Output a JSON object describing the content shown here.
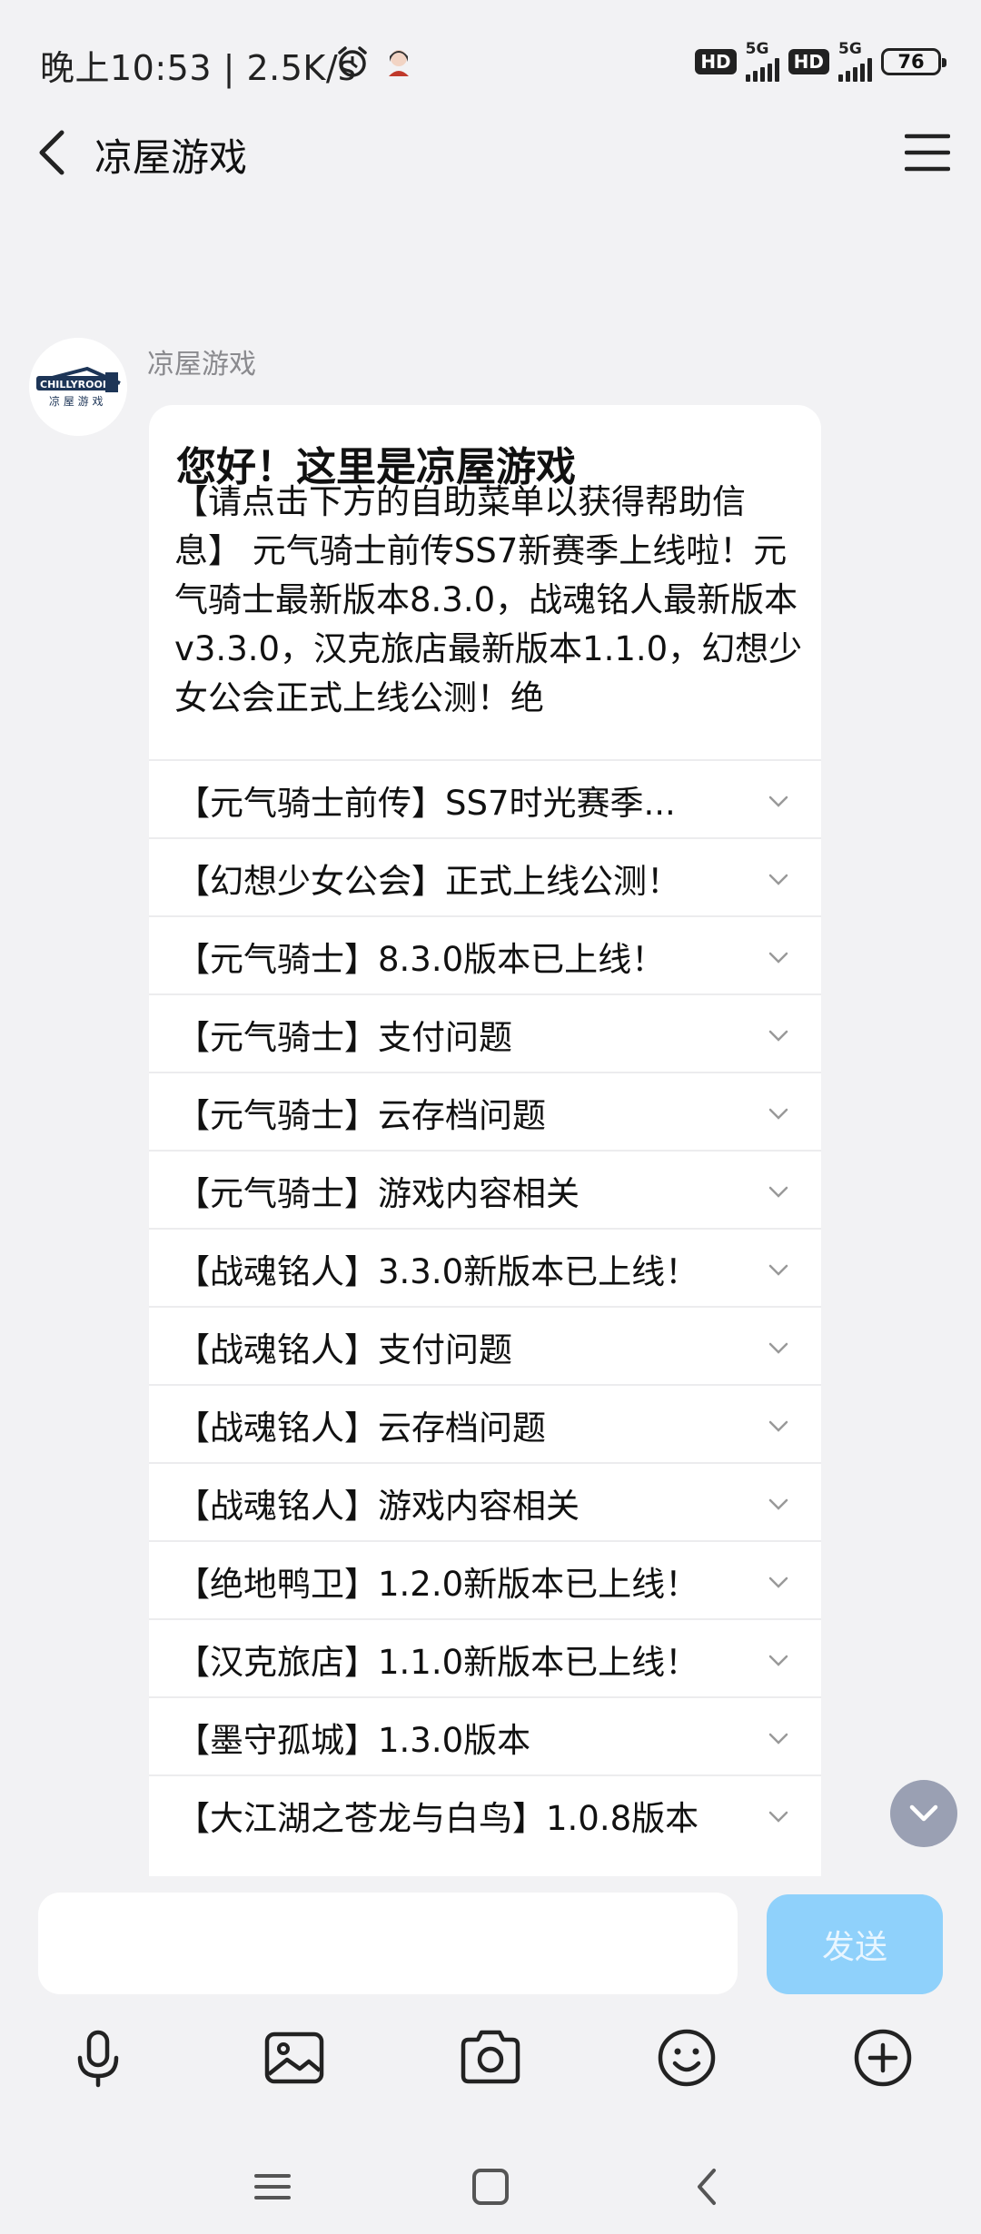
{
  "status_bar": {
    "time_text": "晚上10:53 | 2.5K/s",
    "hd1": "HD",
    "net1": "5G",
    "hd2": "HD",
    "net2": "5G",
    "battery": "76"
  },
  "header": {
    "title": "凉屋游戏",
    "back_icon": "chevron-left-icon",
    "menu_icon": "hamburger-menu-icon"
  },
  "message": {
    "sender": "凉屋游戏",
    "avatar_icon": "chillyroom-logo",
    "title": "您好！这里是凉屋游戏",
    "body": "【请点击下方的自助菜单以获得帮助信息】 元气骑士前传SS7新赛季上线啦！元气骑士最新版本8.3.0，战魂铭人最新版本v3.3.0，汉克旅店最新版本1.1.0，幻想少女公会正式上线公测！绝",
    "menu_items": [
      {
        "label": "【元气骑士前传】SS7时光赛季..."
      },
      {
        "label": "【幻想少女公会】正式上线公测！"
      },
      {
        "label": "【元气骑士】8.3.0版本已上线！"
      },
      {
        "label": "【元气骑士】支付问题"
      },
      {
        "label": "【元气骑士】云存档问题"
      },
      {
        "label": "【元气骑士】游戏内容相关"
      },
      {
        "label": "【战魂铭人】3.3.0新版本已上线！"
      },
      {
        "label": "【战魂铭人】支付问题"
      },
      {
        "label": "【战魂铭人】云存档问题"
      },
      {
        "label": "【战魂铭人】游戏内容相关"
      },
      {
        "label": "【绝地鸭卫】1.2.0新版本已上线！"
      },
      {
        "label": "【汉克旅店】1.1.0新版本已上线！"
      },
      {
        "label": "【墨守孤城】1.3.0版本"
      },
      {
        "label": "【大江湖之苍龙与白鸟】1.0.8版本"
      }
    ]
  },
  "composer": {
    "input_value": "",
    "send_label": "发送",
    "send_color": "#8fd1fb"
  },
  "toolbar": {
    "icons": [
      "microphone-icon",
      "image-icon",
      "camera-icon",
      "emoji-icon",
      "plus-circle-icon"
    ]
  },
  "navbar": {
    "icons": [
      "recent-apps-icon",
      "home-icon",
      "back-icon"
    ]
  }
}
